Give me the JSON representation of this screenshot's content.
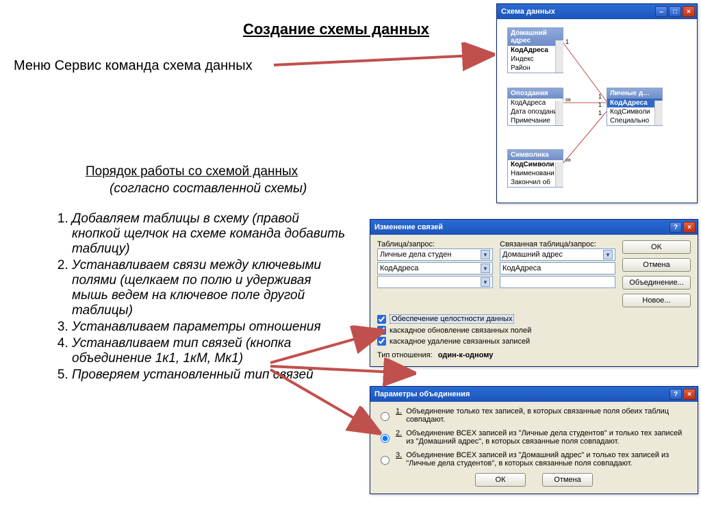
{
  "page_title": "Создание схемы данных",
  "subtitle": "Меню Сервис команда схема данных",
  "section_heading": "Порядок работы со схемой данных",
  "section_sub": "(согласно составленной схемы)",
  "steps": [
    "Добавляем таблицы в схему (правой кнопкой щелчок на схеме команда добавить таблицу)",
    " Устанавливаем связи между ключевыми полями (щелкаем по полю и удерживая мышь ведем на ключевое поле другой таблицы)",
    "Устанавливаем параметры отношения",
    "Устанавливаем тип связей (кнопка объединение 1к1, 1кМ, Мк1)",
    "Проверяем установленный тип связей"
  ],
  "schema_window": {
    "title": "Схема данных",
    "tables": [
      {
        "name": "Домашний адрес",
        "fields": [
          "КодАдреса",
          "Индекс",
          "Район"
        ],
        "key_index": 0
      },
      {
        "name": "Опоздания",
        "fields": [
          "КодАдреса",
          "Дата опоздания",
          "Примечание"
        ],
        "key_index": -1
      },
      {
        "name": "Личные д…",
        "fields": [
          "КодАдреса",
          "КодСимволи",
          "Специально"
        ],
        "key_index": 0
      },
      {
        "name": "Символика",
        "fields": [
          "КодСимволи",
          "Наименовани",
          "Закончил об"
        ],
        "key_index": 0
      }
    ]
  },
  "edit_rel_dialog": {
    "title": "Изменение связей",
    "label_table": "Таблица/запрос:",
    "label_related": "Связанная таблица/запрос:",
    "table_left": "Личные дела студен",
    "table_right": "Домашний адрес",
    "field_left": "КодАдреса",
    "field_right": "КодАдреса",
    "chk_integrity": "Обеспечение целостности данных",
    "chk_cascade_update": "каскадное обновление связанных полей",
    "chk_cascade_delete": "каскадное удаление связанных записей",
    "rel_type_label": "Тип отношения:",
    "rel_type_value": "один-к-одному",
    "btn_ok": "OK",
    "btn_cancel": "Отмена",
    "btn_join": "Объединение...",
    "btn_new": "Новое..."
  },
  "join_dialog": {
    "title": "Параметры объединения",
    "options": [
      "Объединение только тех записей, в которых связанные поля обеих таблиц совпадают.",
      "Объединение ВСЕХ записей из \"Личные дела студентов\" и только тех записей из \"Домашний адрес\", в которых связанные поля совпадают.",
      "Объединение ВСЕХ записей из \"Домашний адрес\" и только тех записей из \"Личные дела студентов\", в которых связанные поля совпадают."
    ],
    "selected": 1,
    "btn_ok": "ОК",
    "btn_cancel": "Отмена"
  }
}
